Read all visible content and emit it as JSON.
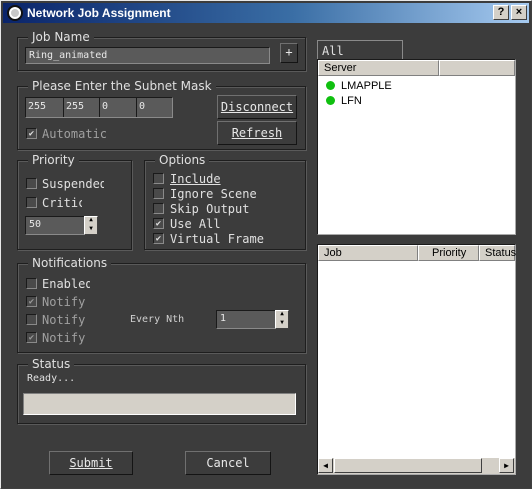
{
  "window": {
    "title": "Network Job Assignment",
    "help_label": "?",
    "close_label": "×"
  },
  "job_name": {
    "label": "Job Name",
    "value": "Ring_animated",
    "browse_label": "+"
  },
  "subnet": {
    "label": "Please Enter the Subnet Mask",
    "octets": [
      "255",
      "255",
      "0",
      "0"
    ],
    "automatic_label": "Automatic",
    "automatic_checked": true,
    "disconnect_label": "Disconnect",
    "refresh_label": "Refresh"
  },
  "priority": {
    "label": "Priority",
    "suspended_label": "Suspended",
    "critical_label": "Critical",
    "value": "50"
  },
  "options": {
    "label": "Options",
    "items": [
      {
        "label": "Include",
        "checked": false
      },
      {
        "label": "Ignore Scene",
        "checked": false
      },
      {
        "label": "Skip Output",
        "checked": false
      },
      {
        "label": "Use All",
        "checked": true
      },
      {
        "label": "Virtual Frame",
        "checked": true
      }
    ]
  },
  "notifications": {
    "label": "Notifications",
    "items": [
      {
        "label": "Enabled",
        "checked": false,
        "dim": false
      },
      {
        "label": "Notify",
        "checked": true,
        "dim": true
      },
      {
        "label": "Notify",
        "checked": false,
        "dim": true
      },
      {
        "label": "Notify",
        "checked": true,
        "dim": true
      }
    ],
    "every_nth_label": "Every Nth",
    "every_nth_value": "1"
  },
  "status": {
    "label": "Status",
    "text": "Ready...",
    "progress": 0
  },
  "buttons": {
    "submit_label": "Submit",
    "cancel_label": "Cancel"
  },
  "servers": {
    "tab_label": "All Servers",
    "column": "Server",
    "rows": [
      {
        "name": "LMAPPLE",
        "status_color": "#10c010"
      },
      {
        "name": "LFN",
        "status_color": "#10c010"
      }
    ]
  },
  "jobs": {
    "columns": [
      "Job",
      "Priority",
      "Status"
    ],
    "scroll_left": "◀",
    "scroll_right": "▶"
  }
}
